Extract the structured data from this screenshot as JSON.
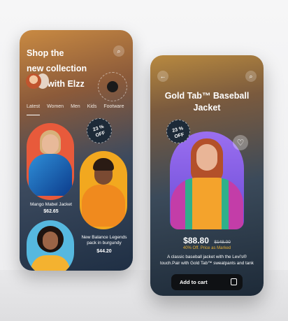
{
  "screen1": {
    "title_line1": "Shop the",
    "title_line2": "new collection",
    "title_line3": "with Elzz",
    "tabs": [
      "Latest",
      "Women",
      "Men",
      "Kids",
      "Footware"
    ],
    "active_tab": "Latest",
    "badge_line1": "23 %",
    "badge_line2": "OFF",
    "products": [
      {
        "name": "Mango Mabel Jacket",
        "price": "$62.65"
      },
      {
        "name": "New Balance Legends pack in burgundy",
        "price": "$44.20"
      }
    ]
  },
  "screen2": {
    "title": "Gold Tab™ Baseball Jacket",
    "badge_line1": "23 %",
    "badge_line2": "OFF",
    "price": "$88.80",
    "old_price": "$148.00",
    "discount_text": "40% Off. Price as Marked",
    "description": "A classic baseball jacket with the Levi's® touch.Pair with Gold Tab™ sweatpants and tank",
    "cart_label": "Add to cart"
  },
  "icons": {
    "back": "←",
    "search": "⌕",
    "heart": "♡"
  }
}
